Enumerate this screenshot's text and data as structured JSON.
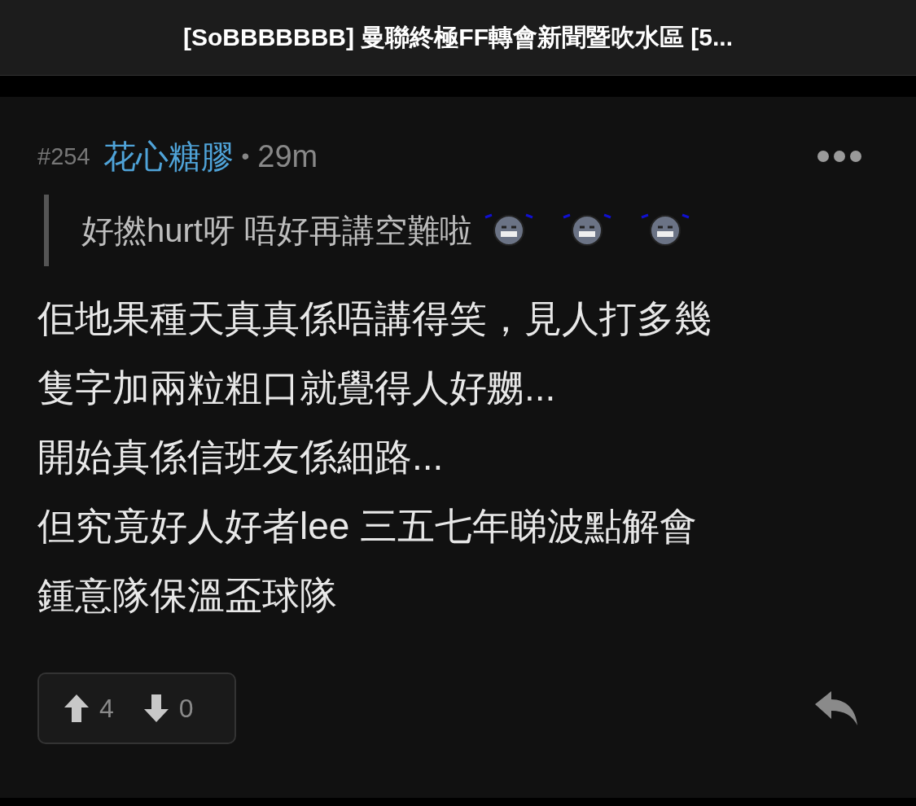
{
  "header": {
    "title": "[SoBBBBBBB] 曼聯終極FF轉會新聞暨吹水區 [5..."
  },
  "post": {
    "number": "#254",
    "author": "花心糖膠",
    "separator": "•",
    "time": "29m",
    "quote": {
      "text": "好撚hurt呀 唔好再講空難啦"
    },
    "body_lines": [
      "佢地果種天真真係唔講得笑，見人打多幾",
      "隻字加兩粒粗口就覺得人好嬲...",
      "開始真係信班友係細路...",
      "但究竟好人好者lee 三五七年睇波點解會",
      "鍾意隊保溫盃球隊"
    ],
    "votes": {
      "up": "4",
      "down": "0"
    }
  }
}
